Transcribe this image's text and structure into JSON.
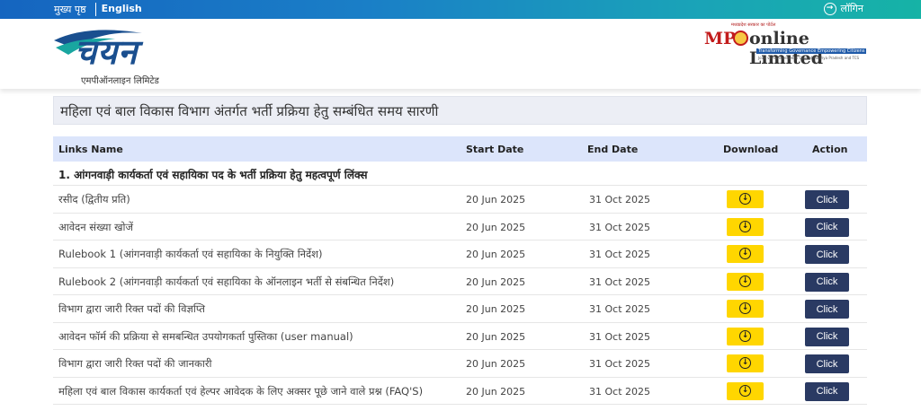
{
  "topbar": {
    "home": "मुख्य पृष्ठ",
    "language": "English",
    "login": "लॉगिन"
  },
  "header": {
    "logo_left_text": "चयन",
    "logo_left_subtitle": "एमपीऑनलाइन लिमिटेड",
    "logo_right_tiny": "मध्यप्रदेश सरकार का पोर्टल",
    "logo_right_mp": "MP",
    "logo_right_online": "online Limited",
    "logo_right_tagline": "Transforming Governance Empowering Citizens",
    "logo_right_sub": "Joint venture between Govt of Madhya Pradesh and TCS"
  },
  "page_title": "महिला एवं बाल विकास विभाग अंतर्गत भर्ती प्रक्रिया हेतु सम्बंधित समय सारणी",
  "table": {
    "headers": {
      "links_name": "Links Name",
      "start_date": "Start Date",
      "end_date": "End Date",
      "download": "Download",
      "action": "Action"
    },
    "section_title": "1. आंगनवाड़ी कार्यकर्ता एवं सहायिका पद के भर्ती प्रक्रिया हेतु महत्वपूर्ण लिंक्स",
    "rows": [
      {
        "name": "रसीद (द्वितीय प्रति)",
        "start": "20 Jun 2025",
        "end": "31 Oct 2025",
        "action": "Click"
      },
      {
        "name": "आवेदन संख्या खोजें",
        "start": "20 Jun 2025",
        "end": "31 Oct 2025",
        "action": "Click"
      },
      {
        "name": "Rulebook 1 (आंगनवाड़ी कार्यकर्ता एवं सहायिका के नियुक्ति निर्देश)",
        "start": "20 Jun 2025",
        "end": "31 Oct 2025",
        "action": "Click"
      },
      {
        "name": "Rulebook 2 (आंगनवाड़ी कार्यकर्ता एवं सहायिका के ऑनलाइन भर्ती से संबन्धित निर्देश)",
        "start": "20 Jun 2025",
        "end": "31 Oct 2025",
        "action": "Click"
      },
      {
        "name": "विभाग द्वारा जारी रिक्त पदों की विज्ञप्ति",
        "start": "20 Jun 2025",
        "end": "31 Oct 2025",
        "action": "Click"
      },
      {
        "name": "आवेदन फॉर्म की प्रक्रिया से समबन्धित उपयोगकर्ता पुस्तिका (user manual)",
        "start": "20 Jun 2025",
        "end": "31 Oct 2025",
        "action": "Click"
      },
      {
        "name": "विभाग द्वारा जारी रिक्त पदों की जानकारी",
        "start": "20 Jun 2025",
        "end": "31 Oct 2025",
        "action": "Click"
      },
      {
        "name": "महिला एवं बाल विकास कार्यकर्ता एवं हेल्पर आवेदक के लिए अक्सर पूछे जाने वाले प्रश्न (FAQ'S)",
        "start": "20 Jun 2025",
        "end": "31 Oct 2025",
        "action": "Click"
      }
    ]
  },
  "icons": {
    "download": "download-circle-icon",
    "login": "login-arrow-icon"
  },
  "colors": {
    "topbar_start": "#1565c0",
    "topbar_end": "#16b3a6",
    "header_row": "#dce5fb",
    "download_button": "#ffd600",
    "action_button": "#2a3a63"
  }
}
